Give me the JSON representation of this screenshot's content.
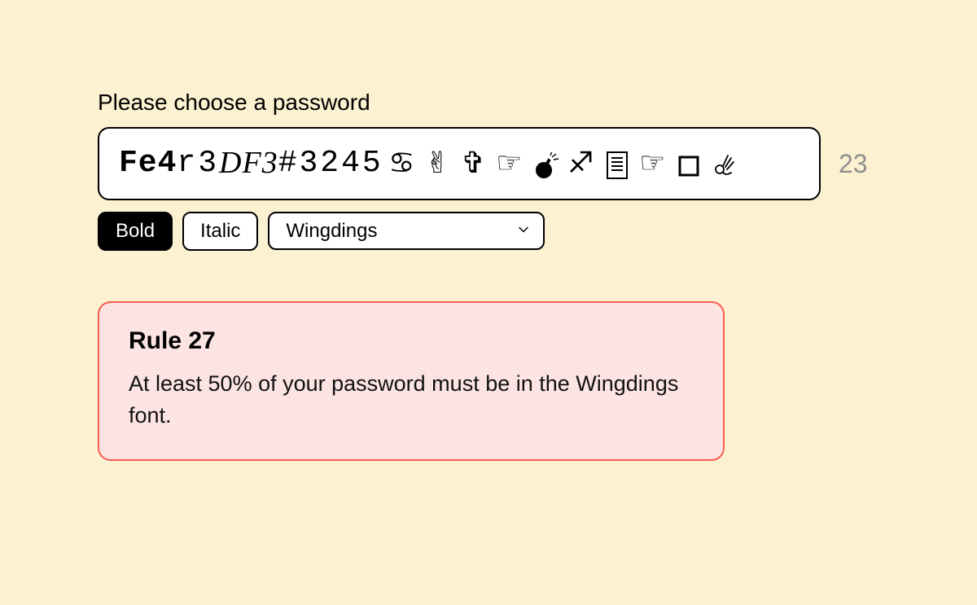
{
  "prompt": "Please choose a password",
  "password": {
    "segments": {
      "bold": "Fe4",
      "plain1": "r3",
      "italic": "DF3",
      "plain2": "#3245"
    },
    "wingdings_glyphs": [
      "cancer",
      "victory-hand",
      "cross",
      "point-right",
      "bomb",
      "sagittarius",
      "document",
      "point-right",
      "square",
      "ok-hand"
    ],
    "length": "23"
  },
  "toolbar": {
    "bold_label": "Bold",
    "bold_active": true,
    "italic_label": "Italic",
    "italic_active": false,
    "font_selected": "Wingdings"
  },
  "rule": {
    "title": "Rule 27",
    "text": "At least 50% of your password must be in the Wingdings font."
  }
}
